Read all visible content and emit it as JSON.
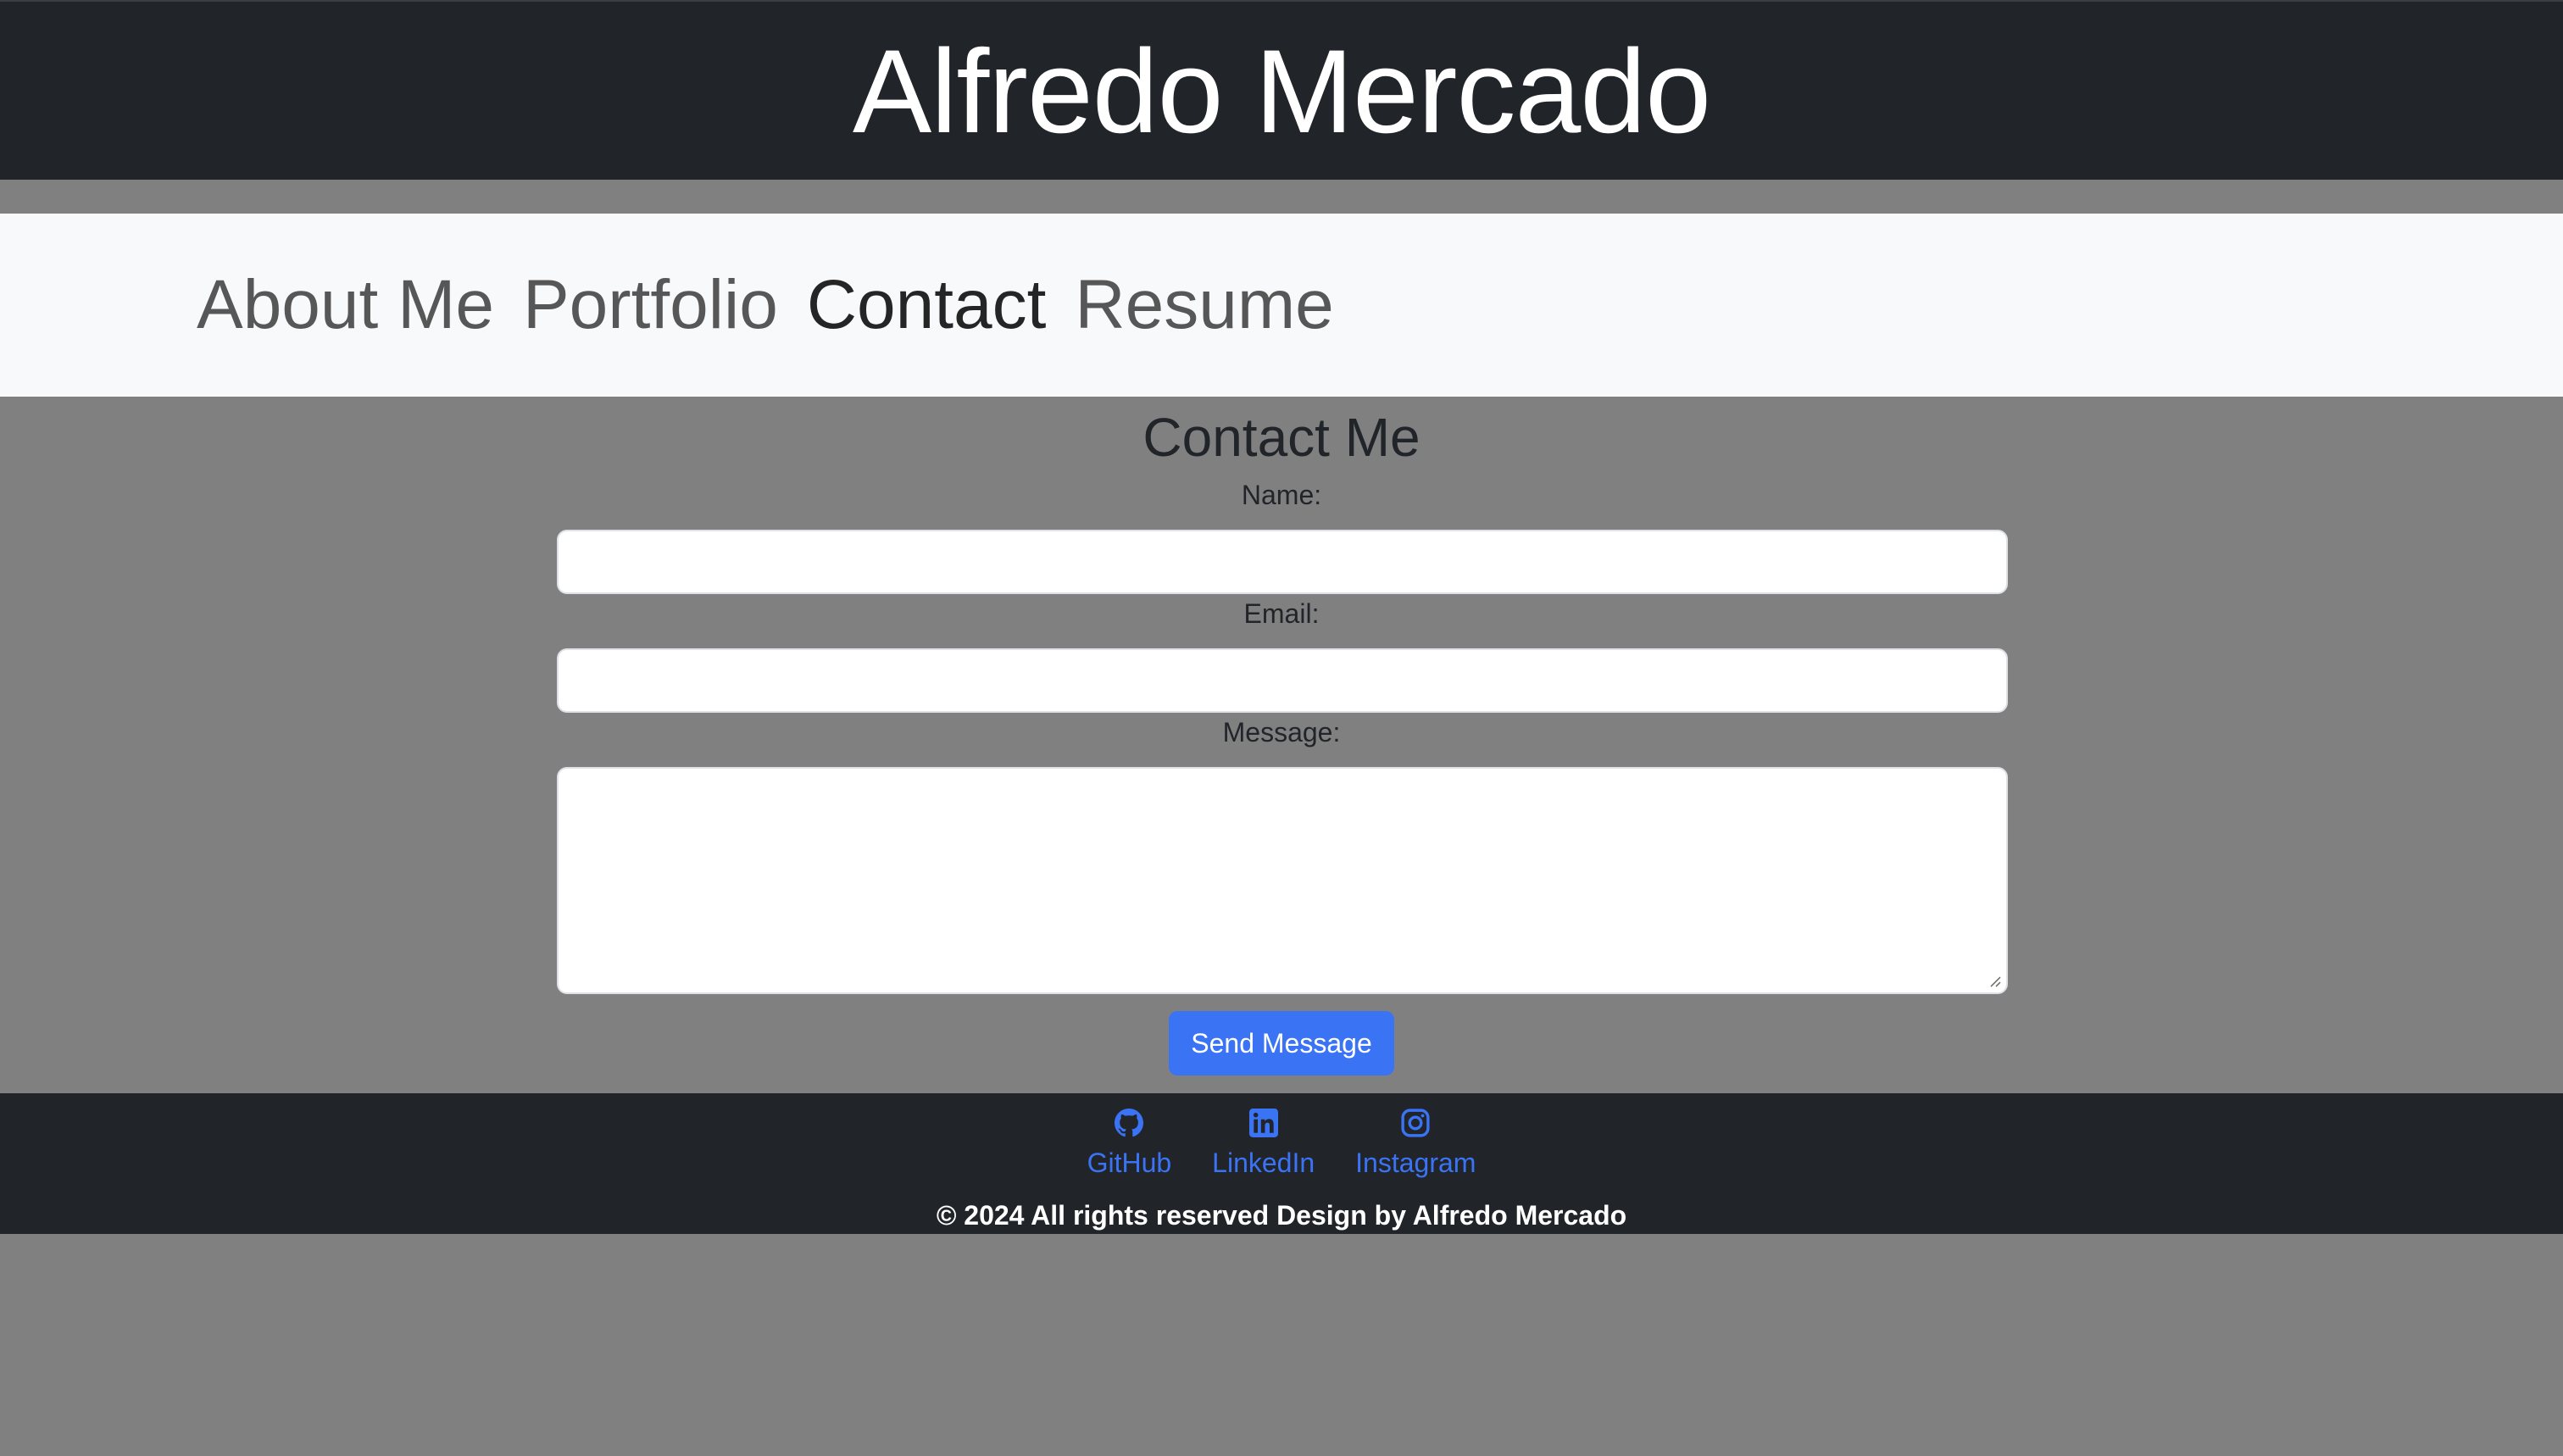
{
  "header": {
    "title": "Alfredo Mercado"
  },
  "nav": {
    "items": [
      {
        "label": "About Me",
        "active": false
      },
      {
        "label": "Portfolio",
        "active": false
      },
      {
        "label": "Contact",
        "active": true
      },
      {
        "label": "Resume",
        "active": false
      }
    ]
  },
  "contact": {
    "heading": "Contact Me",
    "name_label": "Name:",
    "name_value": "",
    "email_label": "Email:",
    "email_value": "",
    "message_label": "Message:",
    "message_value": "",
    "send_label": "Send Message"
  },
  "footer": {
    "links": [
      {
        "label": "GitHub",
        "icon": "github-icon"
      },
      {
        "label": "LinkedIn",
        "icon": "linkedin-icon"
      },
      {
        "label": "Instagram",
        "icon": "instagram-icon"
      }
    ],
    "copyright": "© 2024 All rights reserved Design by Alfredo Mercado"
  },
  "colors": {
    "dark": "#212529",
    "page_bg": "#808080",
    "navbar_bg": "#f8f9fa",
    "accent": "#3b73f5"
  }
}
